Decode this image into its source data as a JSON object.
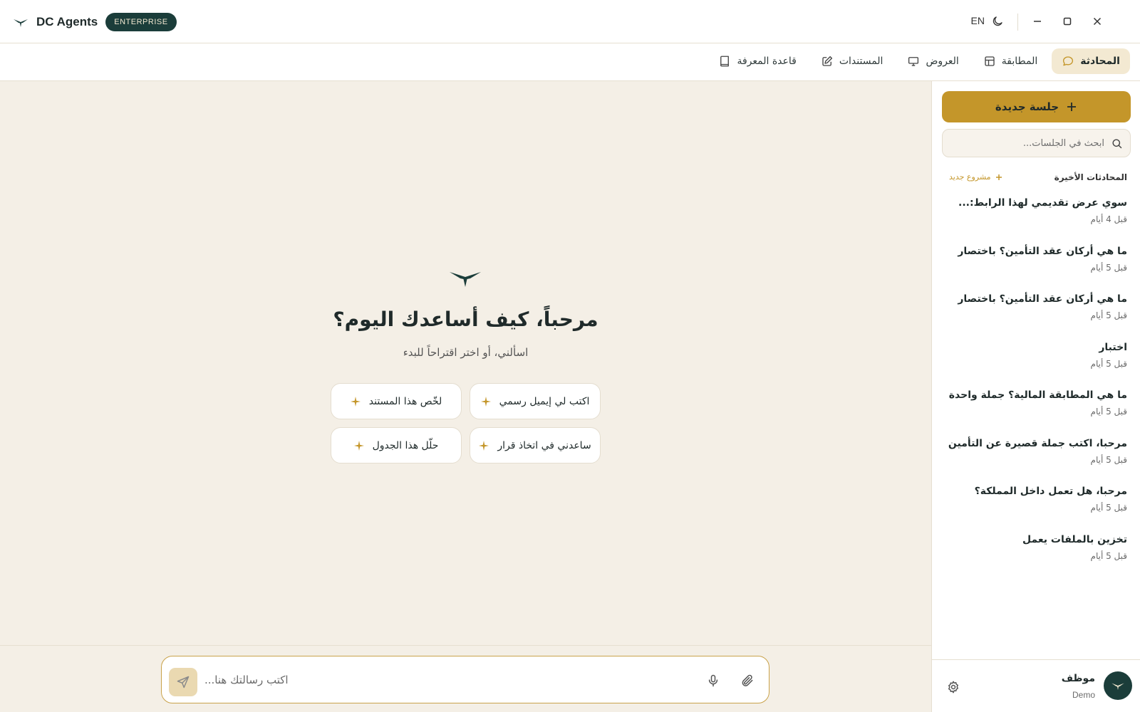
{
  "app": {
    "name": "DC Agents",
    "badge": "ENTERPRISE",
    "language": "EN"
  },
  "colors": {
    "brand_dark": "#1b3d3a",
    "gold": "#c4962a",
    "background": "#f4efe6"
  },
  "window_controls": [
    "moon-icon",
    "minimize-icon",
    "maximize-icon",
    "close-icon"
  ],
  "nav": {
    "tabs": [
      {
        "label": "المحادثة",
        "icon": "chat-icon",
        "active": true
      },
      {
        "label": "المطابقة",
        "icon": "layout-icon",
        "active": false
      },
      {
        "label": "العروض",
        "icon": "monitor-icon",
        "active": false
      },
      {
        "label": "المستندات",
        "icon": "edit-icon",
        "active": false
      },
      {
        "label": "قاعدة المعرفة",
        "icon": "book-icon",
        "active": false
      }
    ]
  },
  "sidebar": {
    "new_session_label": "جلسة جديدة",
    "search_placeholder": "ابحث في الجلسات...",
    "recent_heading": "المحادثات الأخيرة",
    "new_project_label": "مشروع جديد",
    "sessions": [
      {
        "title": "سوي عرض تقديمي لهذا الرابط:...",
        "time": "قبل 4 أيام"
      },
      {
        "title": "ما هي أركان عقد التأمين؟ باختصار",
        "time": "قبل 5 أيام"
      },
      {
        "title": "ما هي أركان عقد التأمين؟ باختصار",
        "time": "قبل 5 أيام"
      },
      {
        "title": "اختبار",
        "time": "قبل 5 أيام"
      },
      {
        "title": "ما هي المطابقة المالية؟ جملة واحدة",
        "time": "قبل 5 أيام"
      },
      {
        "title": "مرحبا، اكتب جملة قصيرة عن التأمين",
        "time": "قبل 5 أيام"
      },
      {
        "title": "مرحبا، هل تعمل داخل المملكة؟",
        "time": "قبل 5 أيام"
      },
      {
        "title": "تخزين بالملفات يعمل",
        "time": "قبل 5 أيام"
      }
    ],
    "user": {
      "name": "موظف",
      "role": "Demo"
    }
  },
  "main": {
    "headline": "مرحباً، كيف أساعدك اليوم؟",
    "subline": "اسألني، أو اختر اقتراحاً للبدء",
    "suggestions": [
      "اكتب لي إيميل رسمي",
      "لخّص هذا المستند",
      "ساعدني في اتخاذ قرار",
      "حلّل هذا الجدول"
    ],
    "composer_placeholder": "اكتب رسالتك هنا..."
  }
}
